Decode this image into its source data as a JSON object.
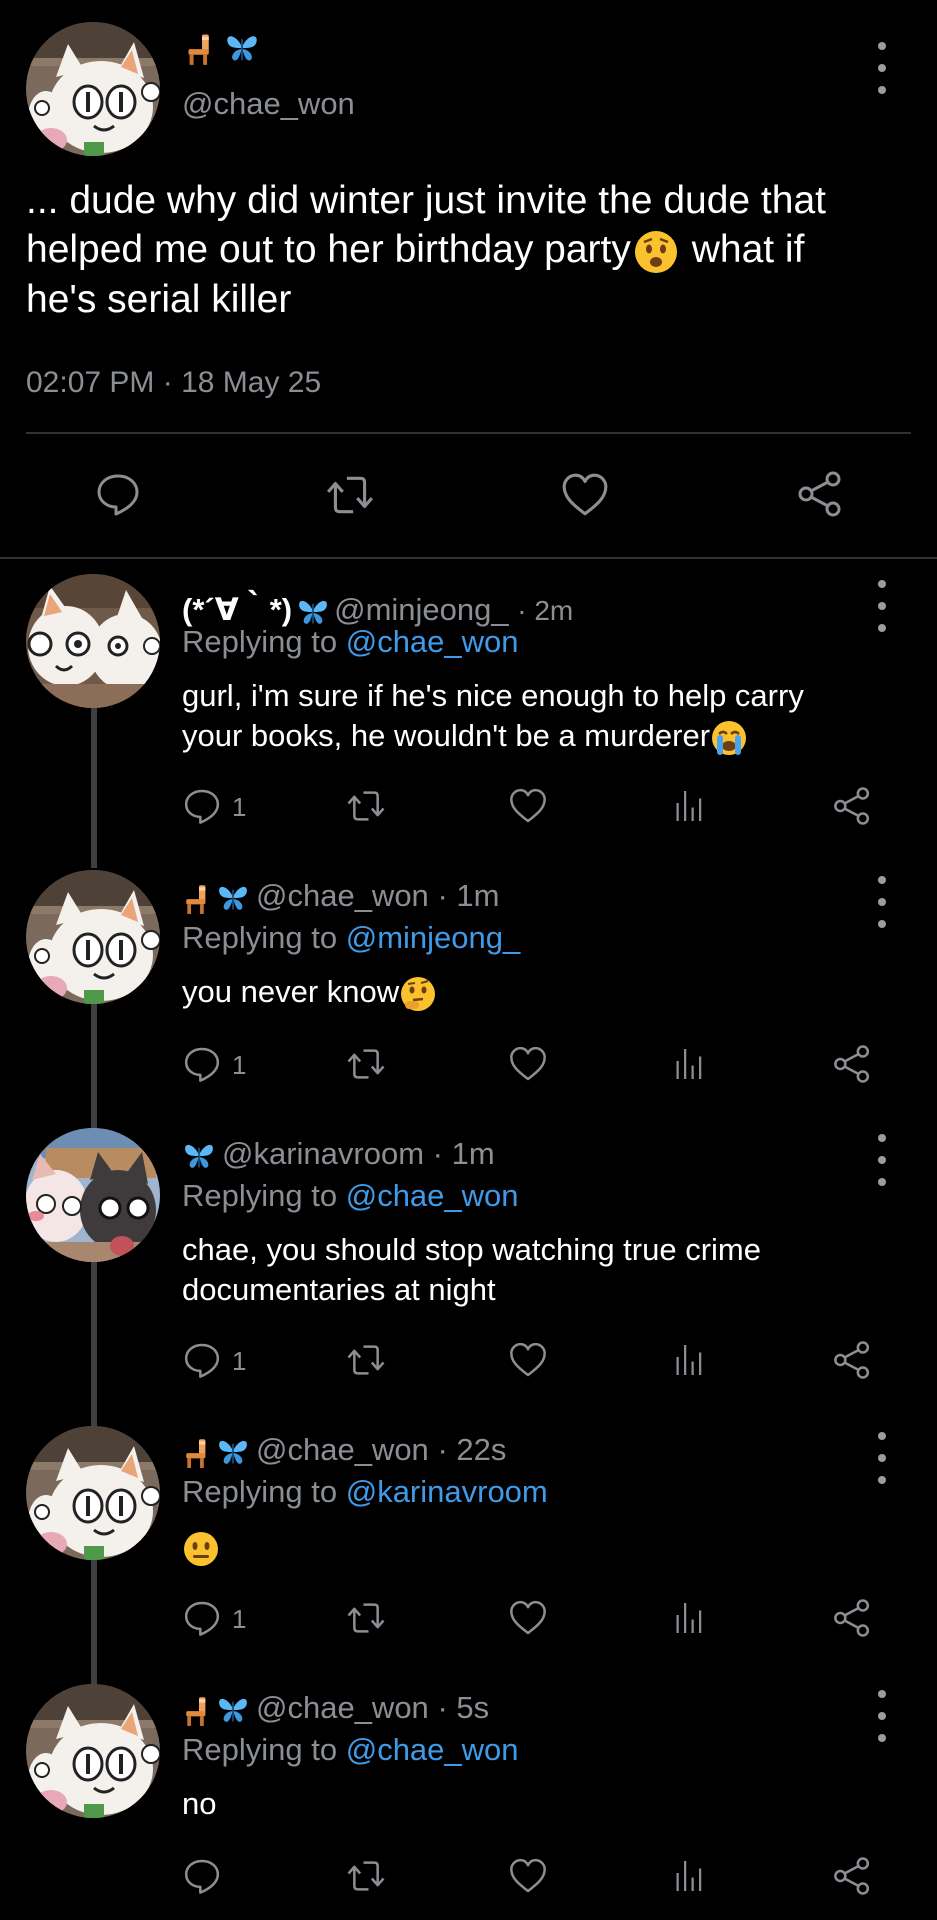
{
  "colors": {
    "background": "#000000",
    "text": "#ffffff",
    "muted": "#8b8f94",
    "link": "#3f9ae8",
    "divider": "#2f3336"
  },
  "main_tweet": {
    "handle": "@chae_won",
    "name_icons": [
      "chair-icon",
      "butterfly-icon"
    ],
    "text_line1": "... dude why did winter just invite the dude that",
    "text_line2a": "helped me out to her birthday party",
    "text_line2b": " what if",
    "text_line3": "he's serial killer",
    "emoji": "worried-face-emoji",
    "timestamp": "02:07 PM · 18 May 25"
  },
  "replies": [
    {
      "display_name": "(*´∀｀*)",
      "handle": "@minjeong_",
      "time": "· 2m",
      "replying_label": "Replying to",
      "replying_to": "@chae_won",
      "text_line1": "gurl, i'm sure if he's nice enough to help carry",
      "text_line2": "your books, he wouldn't be a murderer",
      "reply_count": "1"
    },
    {
      "display_name": "",
      "handle": "@chae_won",
      "time": "· 1m",
      "replying_label": "Replying to",
      "replying_to": "@minjeong_",
      "text_line1": "you never know",
      "text_line2": "",
      "reply_count": "1"
    },
    {
      "display_name": "",
      "handle": "@karinavroom",
      "time": "· 1m",
      "replying_label": "Replying to",
      "replying_to": "@chae_won",
      "text_line1": "chae, you should stop watching true crime",
      "text_line2": "documentaries at night",
      "reply_count": "1"
    },
    {
      "display_name": "",
      "handle": "@chae_won",
      "time": "· 22s",
      "replying_label": "Replying to",
      "replying_to": "@karinavroom",
      "text_line1": "",
      "text_line2": "",
      "reply_count": "1"
    },
    {
      "display_name": "",
      "handle": "@chae_won",
      "time": "· 5s",
      "replying_label": "Replying to",
      "replying_to": "@chae_won",
      "text_line1": "no",
      "text_line2": "",
      "reply_count": ""
    }
  ]
}
